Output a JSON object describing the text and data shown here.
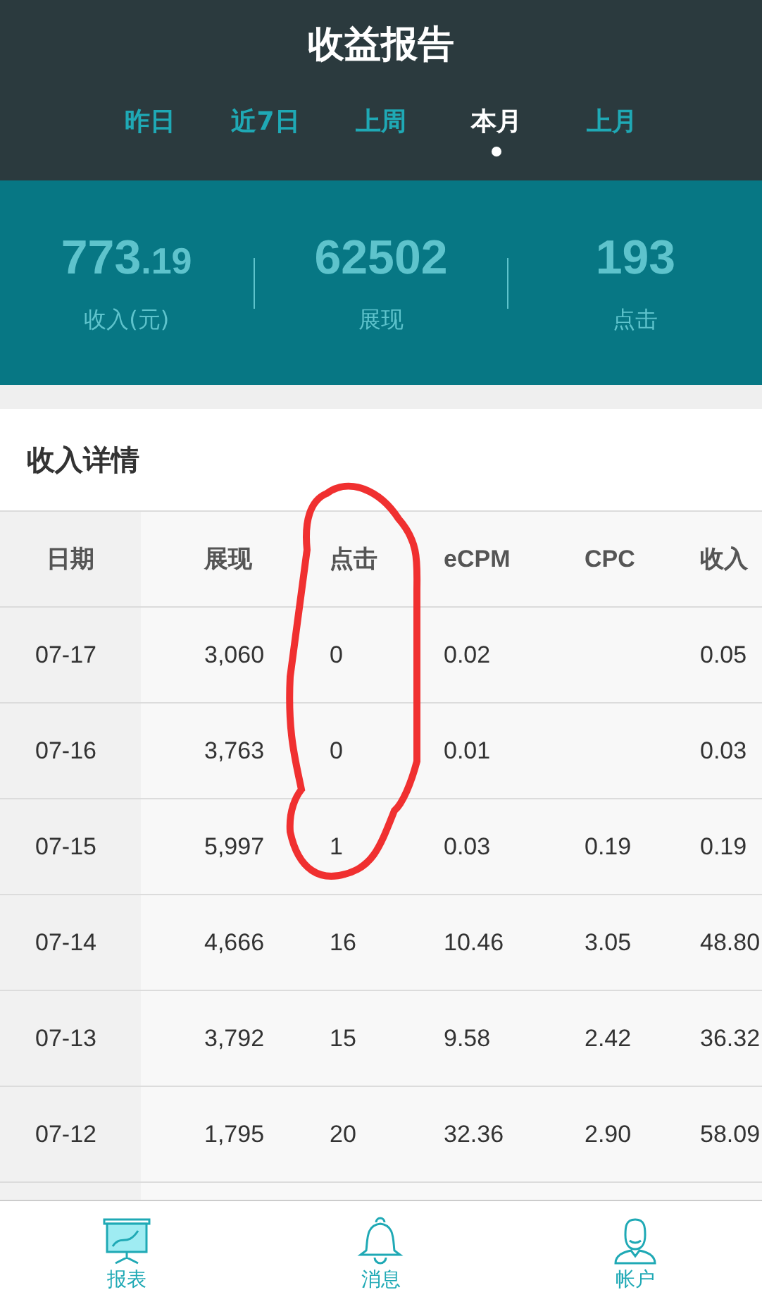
{
  "header": {
    "title": "收益报告"
  },
  "tabs": [
    {
      "label": "昨日",
      "selected": false
    },
    {
      "label": "近7日",
      "selected": false
    },
    {
      "label": "上周",
      "selected": false
    },
    {
      "label": "本月",
      "selected": true
    },
    {
      "label": "上月",
      "selected": false
    }
  ],
  "stats": [
    {
      "value": "773",
      "decimal": ".19",
      "label": "收入(元)"
    },
    {
      "value": "62502",
      "label": "展现"
    },
    {
      "value": "193",
      "label": "点击"
    }
  ],
  "details": {
    "title": "收入详情",
    "table": {
      "columns": [
        "日期",
        "展现",
        "点击",
        "eCPM",
        "CPC",
        "收入"
      ],
      "rows": [
        {
          "date": "07-17",
          "views": "3,060",
          "clicks": "0",
          "ecpm": "0.02",
          "income": "0.05"
        },
        {
          "date": "07-16",
          "views": "3,763",
          "clicks": "0",
          "ecpm": "0.01",
          "income": "0.03"
        },
        {
          "date": "07-15",
          "views": "5,997",
          "clicks": "1",
          "ecpm": "0.03",
          "cpc": "0.19",
          "income": "0.19"
        },
        {
          "date": "07-14",
          "views": "4,666",
          "clicks": "16",
          "ecpm": "10.46",
          "cpc": "3.05",
          "income": "48.80"
        },
        {
          "date": "07-13",
          "views": "3,792",
          "clicks": "15",
          "ecpm": "9.58",
          "cpc": "2.42",
          "income": "36.32"
        },
        {
          "date": "07-12",
          "views": "1,795",
          "clicks": "20",
          "ecpm": "32.36",
          "cpc": "2.90",
          "income": "58.09"
        }
      ]
    }
  },
  "annotation": {
    "kind": "circle"
  },
  "nav": [
    {
      "kind": "chart",
      "label": "报表",
      "selected": true
    },
    {
      "kind": "bell",
      "label": "消息",
      "selected": false
    },
    {
      "kind": "person",
      "label": "帐户",
      "selected": false
    }
  ]
}
